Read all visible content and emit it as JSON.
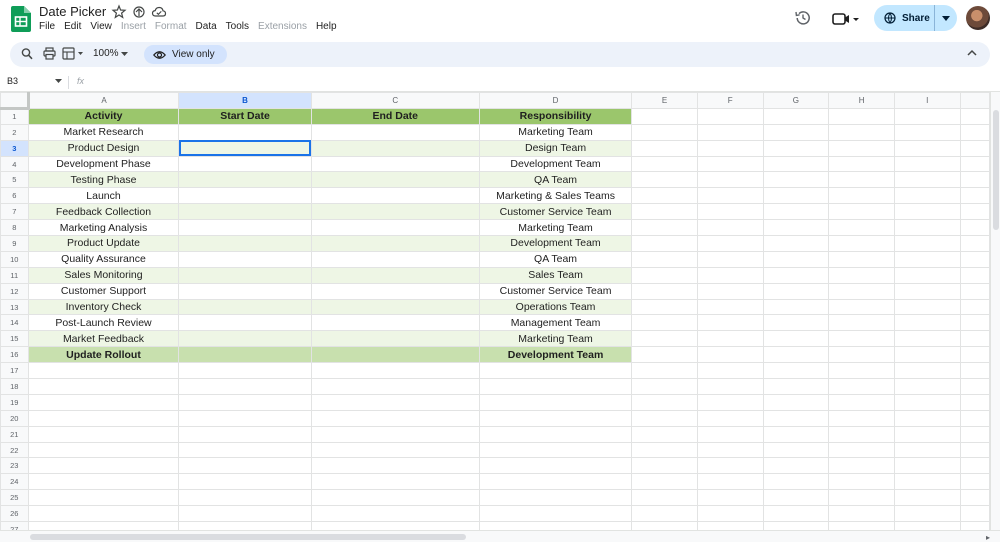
{
  "app": {
    "title": "Date Picker",
    "menu": [
      {
        "label": "File",
        "enabled": true
      },
      {
        "label": "Edit",
        "enabled": true
      },
      {
        "label": "View",
        "enabled": true
      },
      {
        "label": "Insert",
        "enabled": false
      },
      {
        "label": "Format",
        "enabled": false
      },
      {
        "label": "Data",
        "enabled": true
      },
      {
        "label": "Tools",
        "enabled": true
      },
      {
        "label": "Extensions",
        "enabled": false
      },
      {
        "label": "Help",
        "enabled": true
      }
    ],
    "share_label": "Share",
    "brand_color": "#0f9d58"
  },
  "toolbar": {
    "zoom": "100%",
    "view_only_label": "View only"
  },
  "formula_bar": {
    "name_box": "B3",
    "fx": "fx",
    "content": ""
  },
  "sheet": {
    "columns": [
      "A",
      "B",
      "C",
      "D",
      "E",
      "F",
      "G",
      "H",
      "I"
    ],
    "selected_column": "B",
    "selected_row": 3,
    "rows": [
      [
        "Activity",
        "Start Date",
        "End Date",
        "Responsibility"
      ],
      [
        "Market Research",
        "",
        "",
        "Marketing Team"
      ],
      [
        "Product Design",
        "",
        "",
        "Design Team"
      ],
      [
        "Development Phase",
        "",
        "",
        "Development Team"
      ],
      [
        "Testing Phase",
        "",
        "",
        "QA Team"
      ],
      [
        "Launch",
        "",
        "",
        "Marketing & Sales Teams"
      ],
      [
        "Feedback Collection",
        "",
        "",
        "Customer Service Team"
      ],
      [
        "Marketing Analysis",
        "",
        "",
        "Marketing Team"
      ],
      [
        "Product Update",
        "",
        "",
        "Development Team"
      ],
      [
        "Quality Assurance",
        "",
        "",
        "QA Team"
      ],
      [
        "Sales Monitoring",
        "",
        "",
        "Sales Team"
      ],
      [
        "Customer Support",
        "",
        "",
        "Customer Service Team"
      ],
      [
        "Inventory Check",
        "",
        "",
        "Operations Team"
      ],
      [
        "Post-Launch Review",
        "",
        "",
        "Management Team"
      ],
      [
        "Market Feedback",
        "",
        "",
        "Marketing Team"
      ],
      [
        "Update Rollout",
        "",
        "",
        "Development Team"
      ]
    ],
    "total_visible_rows": 28,
    "colors": {
      "header_fill": "#9bc66c",
      "band_fill": "#eef6e5",
      "last_row_fill": "#c8e0ae",
      "selection": "#1a73e8"
    }
  }
}
